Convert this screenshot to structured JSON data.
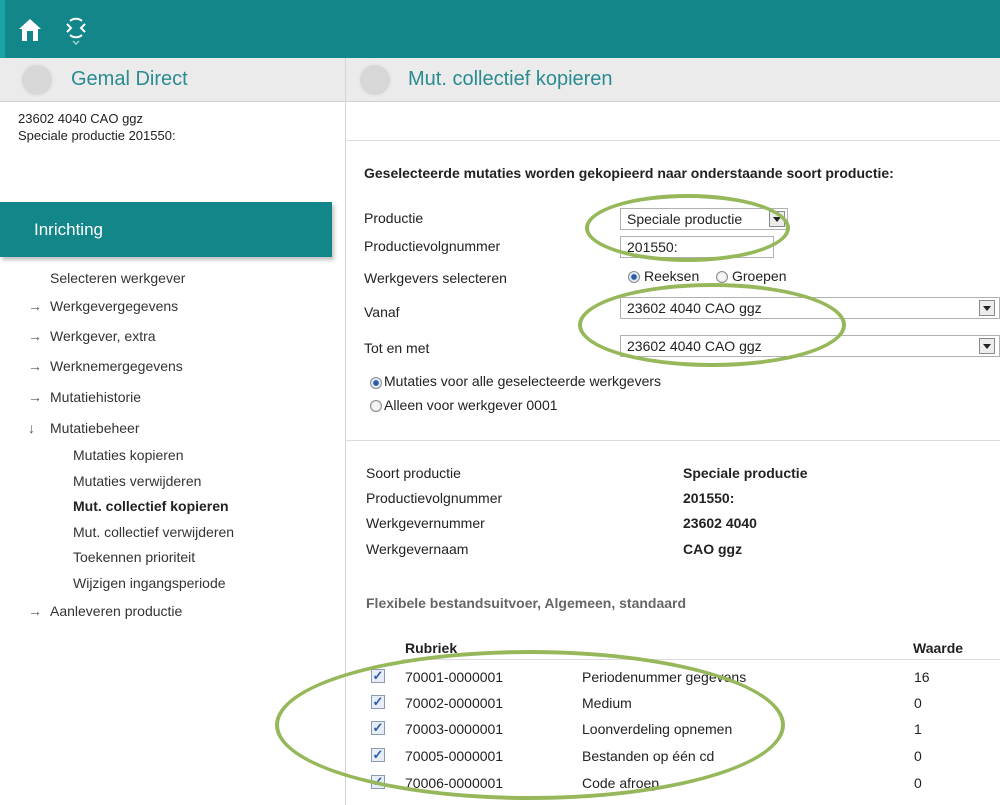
{
  "top_icons": {
    "home": "home-icon",
    "sync": "sync-icon"
  },
  "left_header": {
    "title": "Gemal Direct"
  },
  "right_header": {
    "title": "Mut. collectief kopieren"
  },
  "context": {
    "line1": "23602 4040 CAO ggz",
    "line2": "Speciale productie  201550:"
  },
  "sidebar": {
    "section_title": "Inrichting",
    "items": [
      {
        "label": "Selecteren werkgever",
        "arrow": ""
      },
      {
        "label": "Werkgevergegevens",
        "arrow": "→"
      },
      {
        "label": "Werkgever, extra",
        "arrow": "→"
      },
      {
        "label": "Werknemergegevens",
        "arrow": "→"
      },
      {
        "label": "Mutatiehistorie",
        "arrow": "→"
      },
      {
        "label": "Mutatiebeheer",
        "arrow": "↓"
      }
    ],
    "subitems": [
      {
        "label": "Mutaties kopieren"
      },
      {
        "label": "Mutaties verwijderen"
      },
      {
        "label": "Mut. collectief kopieren"
      },
      {
        "label": "Mut. collectief verwijderen"
      },
      {
        "label": "Toekennen prioriteit"
      },
      {
        "label": "Wijzigen ingangsperiode"
      }
    ],
    "last_item": {
      "label": "Aanleveren productie",
      "arrow": "→"
    }
  },
  "form": {
    "instruction": "Geselecteerde mutaties worden gekopieerd naar onderstaande soort productie:",
    "productie_label": "Productie",
    "productie_value": "Speciale productie",
    "volgnummer_label": "Productievolgnummer",
    "volgnummer_value": "201550:",
    "werkgevers_label": "Werkgevers selecteren",
    "radio_reeksen": "Reeksen",
    "radio_groepen": "Groepen",
    "vanaf_label": "Vanaf",
    "vanaf_value": "23602 4040 CAO ggz",
    "totmet_label": "Tot en met",
    "totmet_value": "23602 4040 CAO ggz",
    "option_alle": "Mutaties voor alle geselecteerde werkgevers",
    "option_alleen": "Alleen voor werkgever 0001"
  },
  "summary": {
    "rows": [
      {
        "label": "Soort productie",
        "value": "Speciale productie"
      },
      {
        "label": "Productievolgnummer",
        "value": "201550:"
      },
      {
        "label": "Werkgevernummer",
        "value": "23602 4040"
      },
      {
        "label": "Werkgevernaam",
        "value": "CAO ggz"
      }
    ]
  },
  "table": {
    "title": "Flexibele bestandsuitvoer, Algemeen, standaard",
    "col_rubriek": "Rubriek",
    "col_waarde": "Waarde",
    "rows": [
      {
        "code": "70001-0000001",
        "desc": "Periodenummer gegevens",
        "value": "16"
      },
      {
        "code": "70002-0000001",
        "desc": "Medium",
        "value": "0"
      },
      {
        "code": "70003-0000001",
        "desc": "Loonverdeling opnemen",
        "value": "1"
      },
      {
        "code": "70005-0000001",
        "desc": "Bestanden op één cd",
        "value": "0"
      },
      {
        "code": "70006-0000001",
        "desc": "Code afroep",
        "value": "0"
      }
    ]
  },
  "colors": {
    "teal": "#13868a",
    "title_teal": "#2a8c90",
    "highlight": "#96b85a"
  }
}
